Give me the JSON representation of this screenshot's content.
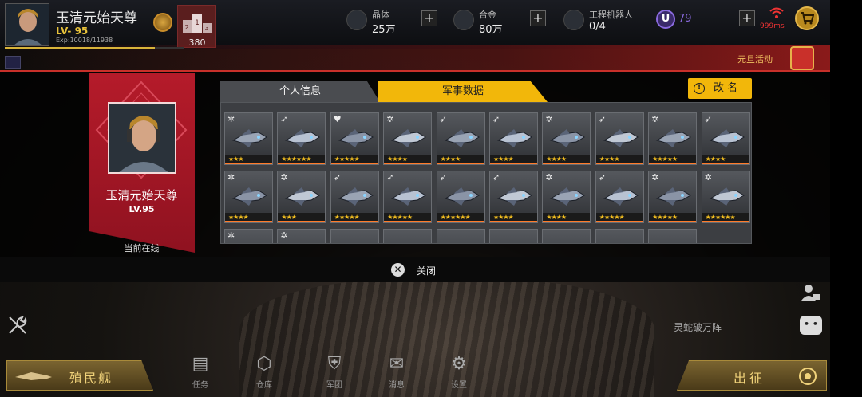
{
  "player": {
    "name": "玉清元始天尊",
    "level": "LV- 95",
    "exp": "Exp:10018/11938",
    "exp_progress": 0.84,
    "rank": "380"
  },
  "resources": [
    {
      "label": "晶体",
      "value": "25万",
      "icon": "crystal-icon",
      "plus": true
    },
    {
      "label": "合金",
      "value": "80万",
      "icon": "alloy-icon",
      "plus": true
    },
    {
      "label": "工程机器人",
      "value": "0/4",
      "icon": "robot-icon",
      "plus": false
    }
  ],
  "premium": {
    "symbol": "U",
    "value": "79"
  },
  "network": {
    "ping": "999ms",
    "color": "#e33333"
  },
  "event": {
    "label": "元旦活动"
  },
  "profile": {
    "name": "玉清元始天尊",
    "level": "LV.95",
    "status": "当前在线"
  },
  "tabs": [
    {
      "label": "个人信息",
      "active": false
    },
    {
      "label": "军事数据",
      "active": true
    }
  ],
  "rename": {
    "label": "改名",
    "icon_glyph": "!"
  },
  "ships": [
    {
      "tag": "gear",
      "stars": 3
    },
    {
      "tag": "rocket",
      "stars": 6
    },
    {
      "tag": "heart",
      "stars": 5
    },
    {
      "tag": "gear",
      "stars": 4
    },
    {
      "tag": "rocket",
      "stars": 4
    },
    {
      "tag": "rocket",
      "stars": 4
    },
    {
      "tag": "gear",
      "stars": 4
    },
    {
      "tag": "rocket",
      "stars": 4
    },
    {
      "tag": "gear",
      "stars": 5
    },
    {
      "tag": "rocket",
      "stars": 4
    },
    {
      "tag": "gear",
      "stars": 4
    },
    {
      "tag": "gear",
      "stars": 3
    },
    {
      "tag": "rocket",
      "stars": 5
    },
    {
      "tag": "rocket",
      "stars": 5
    },
    {
      "tag": "rocket",
      "stars": 6
    },
    {
      "tag": "rocket",
      "stars": 4
    },
    {
      "tag": "gear",
      "stars": 4
    },
    {
      "tag": "rocket",
      "stars": 5
    },
    {
      "tag": "gear",
      "stars": 5
    },
    {
      "tag": "gear",
      "stars": 6
    },
    {
      "tag": "gear",
      "stars": 0
    },
    {
      "tag": "gear",
      "stars": 0
    },
    {
      "tag": "",
      "stars": 0
    },
    {
      "tag": "",
      "stars": 0
    },
    {
      "tag": "",
      "stars": 0
    },
    {
      "tag": "",
      "stars": 0
    },
    {
      "tag": "",
      "stars": 0
    },
    {
      "tag": "",
      "stars": 0
    },
    {
      "tag": "",
      "stars": 0
    }
  ],
  "close": {
    "label": "关闭"
  },
  "side": {
    "label": "灵蛇破万阵"
  },
  "bottom": {
    "colony": "殖民舰",
    "depart": "出征",
    "nav": [
      {
        "label": "任务",
        "icon": "task-icon"
      },
      {
        "label": "仓库",
        "icon": "warehouse-icon"
      },
      {
        "label": "军团",
        "icon": "legion-icon"
      },
      {
        "label": "消息",
        "icon": "message-icon"
      },
      {
        "label": "设置",
        "icon": "settings-icon"
      }
    ]
  },
  "colors": {
    "accent": "#f2b70a",
    "profile_red": "#b51b2a",
    "star": "#f5c020",
    "rarity_bar": "#ff7b2a"
  }
}
